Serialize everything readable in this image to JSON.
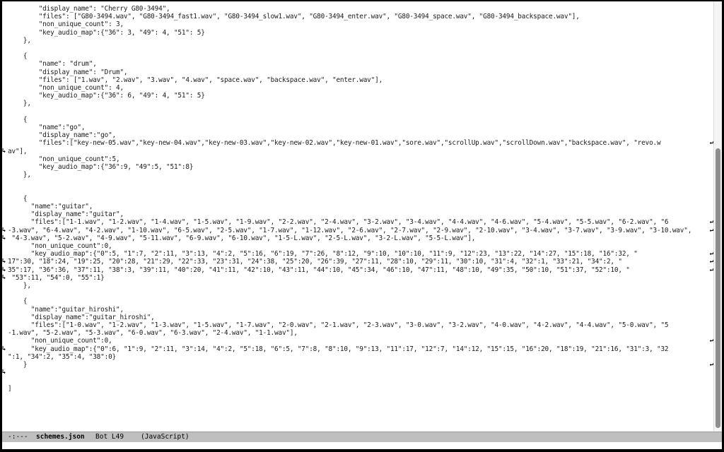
{
  "editor": {
    "lines": [
      "        \"display_name\": \"Cherry G80-3494\",",
      "        \"files\": [\"G80-3494.wav\", \"G80-3494_fast1.wav\", \"G80-3494_slow1.wav\", \"G80-3494_enter.wav\", \"G80-3494_space.wav\", \"G80-3494_backspace.wav\"],",
      "        \"non_unique_count\": 3,",
      "        \"key_audio_map\":{\"36\": 3, \"49\": 4, \"51\": 5}",
      "    },",
      "",
      "    {",
      "        \"name\": \"drum\",",
      "        \"display_name\": \"Drum\",",
      "        \"files\": [\"1.wav\", \"2.wav\", \"3.wav\", \"4.wav\", \"space.wav\", \"backspace.wav\", \"enter.wav\"],",
      "        \"non_unique_count\": 4,",
      "        \"key_audio_map\":{\"36\": 6, \"49\": 4, \"51\": 5}",
      "    },",
      "",
      "    {",
      "        \"name\":\"go\",",
      "        \"display_name\":\"go\",",
      "        \"files\":[\"key-new-05.wav\",\"key-new-04.wav\",\"key-new-03.wav\",\"key-new-02.wav\",\"key-new-01.wav\",\"sore.wav\",\"scrollUp.wav\",\"scrollDown.wav\",\"backspace.wav\", \"revo.w",
      "av\"],",
      "        \"non_unique_count\":5,",
      "        \"key_audio_map\":{\"36\":9, \"49\":5, \"51\":8}",
      "    },",
      "",
      "",
      "    {",
      "      \"name\":\"guitar\",",
      "      \"display_name\":\"guitar\",",
      "      \"files\":[\"1-1.wav\", \"1-2.wav\", \"1-4.wav\", \"1-5.wav\", \"1-9.wav\", \"2-2.wav\", \"2-4.wav\", \"3-2.wav\", \"3-4.wav\", \"4-4.wav\", \"4-6.wav\", \"5-4.wav\", \"5-5.wav\", \"6-2.wav\", \"6",
      "-3.wav\", \"6-4.wav\", \"4-2.wav\", \"1-10.wav\", \"6-5.wav\", \"2-5.wav\", \"1-7.wav\", \"1-12.wav\", \"2-6.wav\", \"2-7.wav\", \"2-9.wav\", \"2-10.wav\", \"3-4.wav\", \"3-7.wav\", \"3-9.wav\", \"3-10.wav\",",
      " \"4-3.wav\", \"5-2.wav\", \"4-9.wav\", \"5-11.wav\", \"6-9.wav\", \"6-10.wav\", \"1-5-L.wav\", \"2-5-L.wav\", \"3-2-L.wav\", \"5-5-L.wav\"],",
      "      \"non_unique_count\":0,",
      "      \"key_audio_map\":{\"0\":5, \"1\":7, \"2\":11, \"3\":13, \"4\":2, \"5\":16, \"6\":19, \"7\":26, \"8\":12, \"9\":10, \"10\":10, \"11\":9, \"12\":23, \"13\":22, \"14\":27, \"15\":18, \"16\":32, \"",
      "17\":30, \"18\":24, \"19\":25, \"20\":28, \"21\":29, \"22\":33, \"23\":31, \"24\":38, \"25\":20, \"26\":39, \"27\":11, \"28\":10, \"29\":11, \"30\":10, \"31\":4, \"32\":1, \"33\":21, \"34\":2, \"",
      "35\":17, \"36\":36, \"37\":11, \"38\":3, \"39\":11, \"40\":20, \"41\":11, \"42\":10, \"43\":11, \"44\":10, \"45\":34, \"46\":10, \"47\":11, \"48\":10, \"49\":35, \"50\":10, \"51\":37, \"52\":10, \"",
      " \"53\":11, \"54\":0, \"55\":1}",
      "    },",
      "",
      "    {",
      "      \"name\":\"guitar_hiroshi\",",
      "      \"display_name\":\"guitar_hiroshi\",",
      "      \"files\":[\"1-0.wav\", \"1-2.wav\", \"1-3.wav\", \"1-5.wav\", \"1-7.wav\", \"2-0.wav\", \"2-1.wav\", \"2-3.wav\", \"3-0.wav\", \"3-2.wav\", \"4-0.wav\", \"4-2.wav\", \"4-4.wav\", \"5-0.wav\", \"5",
      "-1.wav\", \"5-2.wav\", \"5-3.wav\", \"6-0.wav\", \"6-3.wav\", \"2-4.wav\", \"1-1.wav\"],",
      "      \"non_unique_count\":0,",
      "      \"key_audio_map\":{\"0\":6, \"1\":9, \"2\":11, \"3\":14, \"4\":2, \"5\":18, \"6\":5, \"7\":8, \"8\":10, \"9\":13, \"11\":17, \"12\":7, \"14\":12, \"15\":15, \"16\":20, \"18\":19, \"21\":16, \"31\":3, \"32",
      "\":1, \"34\":2, \"35\":4, \"38\":0}",
      "    }",
      "",
      "",
      "]"
    ],
    "continued_lines": [
      18,
      28,
      29,
      32,
      33,
      34,
      43,
      46
    ],
    "wrapped_lines": [
      17,
      27,
      28,
      31,
      32,
      33,
      42,
      45
    ],
    "wrap_glyph": "↵",
    "cont_glyph": "↳"
  },
  "modeline": {
    "status": "-:---",
    "buffer": "schemes.json",
    "position": "Bot L49",
    "mode": "(JavaScript)"
  },
  "scrollbar": {
    "position": 0.33
  }
}
